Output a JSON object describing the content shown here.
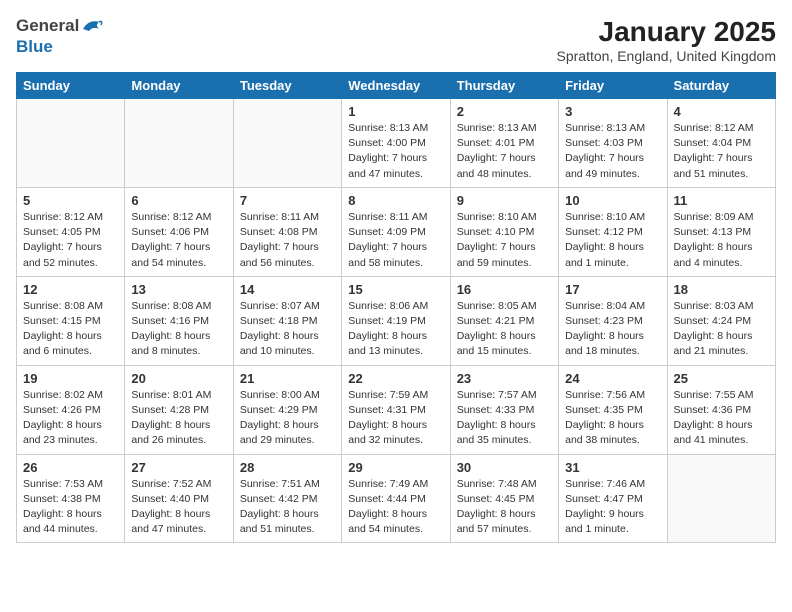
{
  "header": {
    "logo_general": "General",
    "logo_blue": "Blue",
    "month": "January 2025",
    "location": "Spratton, England, United Kingdom"
  },
  "weekdays": [
    "Sunday",
    "Monday",
    "Tuesday",
    "Wednesday",
    "Thursday",
    "Friday",
    "Saturday"
  ],
  "weeks": [
    [
      {
        "day": "",
        "info": ""
      },
      {
        "day": "",
        "info": ""
      },
      {
        "day": "",
        "info": ""
      },
      {
        "day": "1",
        "info": "Sunrise: 8:13 AM\nSunset: 4:00 PM\nDaylight: 7 hours and 47 minutes."
      },
      {
        "day": "2",
        "info": "Sunrise: 8:13 AM\nSunset: 4:01 PM\nDaylight: 7 hours and 48 minutes."
      },
      {
        "day": "3",
        "info": "Sunrise: 8:13 AM\nSunset: 4:03 PM\nDaylight: 7 hours and 49 minutes."
      },
      {
        "day": "4",
        "info": "Sunrise: 8:12 AM\nSunset: 4:04 PM\nDaylight: 7 hours and 51 minutes."
      }
    ],
    [
      {
        "day": "5",
        "info": "Sunrise: 8:12 AM\nSunset: 4:05 PM\nDaylight: 7 hours and 52 minutes."
      },
      {
        "day": "6",
        "info": "Sunrise: 8:12 AM\nSunset: 4:06 PM\nDaylight: 7 hours and 54 minutes."
      },
      {
        "day": "7",
        "info": "Sunrise: 8:11 AM\nSunset: 4:08 PM\nDaylight: 7 hours and 56 minutes."
      },
      {
        "day": "8",
        "info": "Sunrise: 8:11 AM\nSunset: 4:09 PM\nDaylight: 7 hours and 58 minutes."
      },
      {
        "day": "9",
        "info": "Sunrise: 8:10 AM\nSunset: 4:10 PM\nDaylight: 7 hours and 59 minutes."
      },
      {
        "day": "10",
        "info": "Sunrise: 8:10 AM\nSunset: 4:12 PM\nDaylight: 8 hours and 1 minute."
      },
      {
        "day": "11",
        "info": "Sunrise: 8:09 AM\nSunset: 4:13 PM\nDaylight: 8 hours and 4 minutes."
      }
    ],
    [
      {
        "day": "12",
        "info": "Sunrise: 8:08 AM\nSunset: 4:15 PM\nDaylight: 8 hours and 6 minutes."
      },
      {
        "day": "13",
        "info": "Sunrise: 8:08 AM\nSunset: 4:16 PM\nDaylight: 8 hours and 8 minutes."
      },
      {
        "day": "14",
        "info": "Sunrise: 8:07 AM\nSunset: 4:18 PM\nDaylight: 8 hours and 10 minutes."
      },
      {
        "day": "15",
        "info": "Sunrise: 8:06 AM\nSunset: 4:19 PM\nDaylight: 8 hours and 13 minutes."
      },
      {
        "day": "16",
        "info": "Sunrise: 8:05 AM\nSunset: 4:21 PM\nDaylight: 8 hours and 15 minutes."
      },
      {
        "day": "17",
        "info": "Sunrise: 8:04 AM\nSunset: 4:23 PM\nDaylight: 8 hours and 18 minutes."
      },
      {
        "day": "18",
        "info": "Sunrise: 8:03 AM\nSunset: 4:24 PM\nDaylight: 8 hours and 21 minutes."
      }
    ],
    [
      {
        "day": "19",
        "info": "Sunrise: 8:02 AM\nSunset: 4:26 PM\nDaylight: 8 hours and 23 minutes."
      },
      {
        "day": "20",
        "info": "Sunrise: 8:01 AM\nSunset: 4:28 PM\nDaylight: 8 hours and 26 minutes."
      },
      {
        "day": "21",
        "info": "Sunrise: 8:00 AM\nSunset: 4:29 PM\nDaylight: 8 hours and 29 minutes."
      },
      {
        "day": "22",
        "info": "Sunrise: 7:59 AM\nSunset: 4:31 PM\nDaylight: 8 hours and 32 minutes."
      },
      {
        "day": "23",
        "info": "Sunrise: 7:57 AM\nSunset: 4:33 PM\nDaylight: 8 hours and 35 minutes."
      },
      {
        "day": "24",
        "info": "Sunrise: 7:56 AM\nSunset: 4:35 PM\nDaylight: 8 hours and 38 minutes."
      },
      {
        "day": "25",
        "info": "Sunrise: 7:55 AM\nSunset: 4:36 PM\nDaylight: 8 hours and 41 minutes."
      }
    ],
    [
      {
        "day": "26",
        "info": "Sunrise: 7:53 AM\nSunset: 4:38 PM\nDaylight: 8 hours and 44 minutes."
      },
      {
        "day": "27",
        "info": "Sunrise: 7:52 AM\nSunset: 4:40 PM\nDaylight: 8 hours and 47 minutes."
      },
      {
        "day": "28",
        "info": "Sunrise: 7:51 AM\nSunset: 4:42 PM\nDaylight: 8 hours and 51 minutes."
      },
      {
        "day": "29",
        "info": "Sunrise: 7:49 AM\nSunset: 4:44 PM\nDaylight: 8 hours and 54 minutes."
      },
      {
        "day": "30",
        "info": "Sunrise: 7:48 AM\nSunset: 4:45 PM\nDaylight: 8 hours and 57 minutes."
      },
      {
        "day": "31",
        "info": "Sunrise: 7:46 AM\nSunset: 4:47 PM\nDaylight: 9 hours and 1 minute."
      },
      {
        "day": "",
        "info": ""
      }
    ]
  ]
}
